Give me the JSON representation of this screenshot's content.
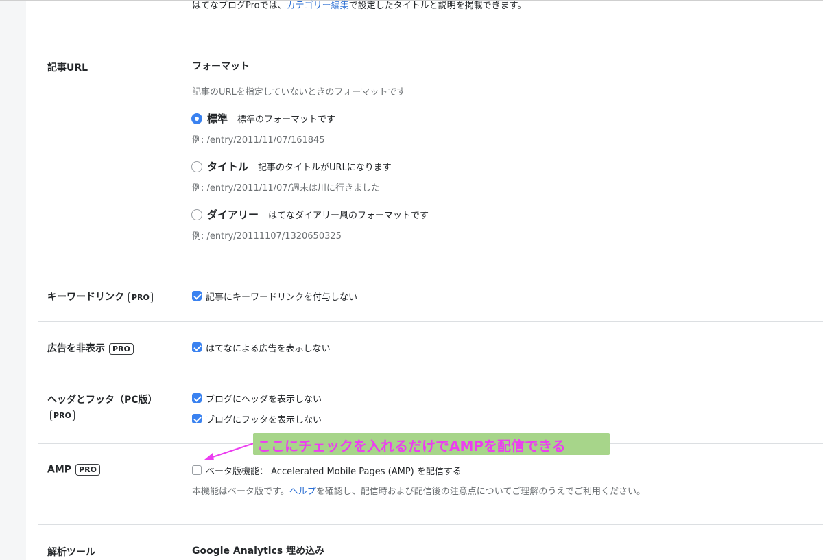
{
  "intro": {
    "prefix": "はてなブログProでは、",
    "link": "カテゴリー編集",
    "suffix": "で設定したタイトルと説明を掲載できます。"
  },
  "article_url": {
    "label": "記事URL",
    "heading": "フォーマット",
    "description": "記事のURLを指定していないときのフォーマットです",
    "options": [
      {
        "title": "標準",
        "desc": "標準のフォーマットです",
        "example": "例: /entry/2011/11/07/161845",
        "selected": true
      },
      {
        "title": "タイトル",
        "desc": "記事のタイトルがURLになります",
        "example": "例: /entry/2011/11/07/週末は川に行きました",
        "selected": false
      },
      {
        "title": "ダイアリー",
        "desc": "はてなダイアリー風のフォーマットです",
        "example": "例: /entry/20111107/1320650325",
        "selected": false
      }
    ]
  },
  "keyword_link": {
    "label": "キーワードリンク",
    "badge": "PRO",
    "checkbox_label": "記事にキーワードリンクを付与しない",
    "checked": true
  },
  "hide_ads": {
    "label": "広告を非表示",
    "badge": "PRO",
    "checkbox_label": "はてなによる広告を表示しない",
    "checked": true
  },
  "header_footer": {
    "label": "ヘッダとフッタ（PC版）",
    "badge": "PRO",
    "items": [
      {
        "label": "ブログにヘッダを表示しない",
        "checked": true
      },
      {
        "label": "ブログにフッタを表示しない",
        "checked": true
      }
    ]
  },
  "amp": {
    "label": "AMP",
    "badge": "PRO",
    "checkbox_label": "ベータ版機能： Accelerated Mobile Pages (AMP) を配信する",
    "checked": false,
    "note_prefix": "本機能はベータ版です。",
    "note_link": "ヘルプ",
    "note_suffix": "を確認し、配信時および配信後の注意点についてご理解のうえでご利用ください。"
  },
  "analytics": {
    "label": "解析ツール",
    "heading": "Google Analytics 埋め込み"
  },
  "annotation": {
    "text": "ここにチェックを入れるだけでAMPを配信できる",
    "color": "#ec3ef0",
    "background": "#a7d58a"
  }
}
